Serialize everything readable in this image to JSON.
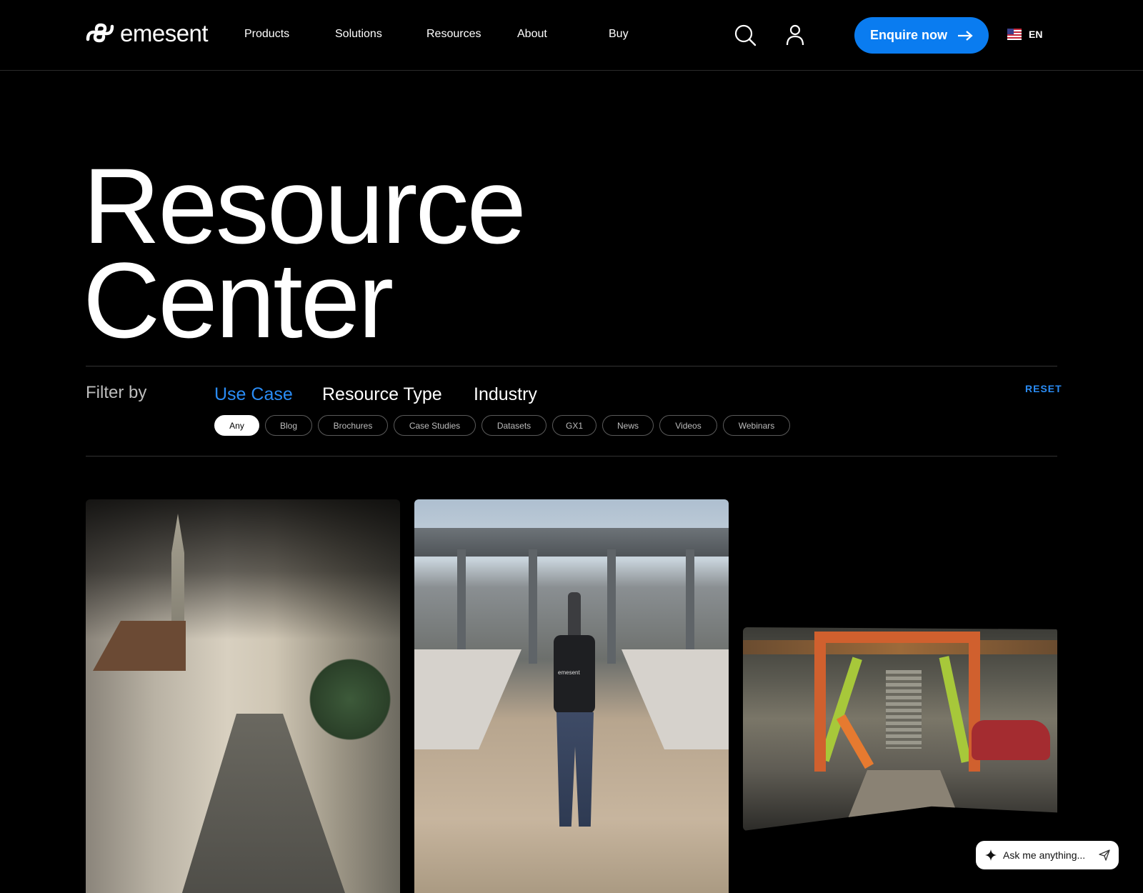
{
  "header": {
    "logo_text": "emesent",
    "nav": [
      {
        "label": "Products"
      },
      {
        "label": "Solutions"
      },
      {
        "label": "Resources"
      },
      {
        "label": "About"
      },
      {
        "label": "Buy"
      }
    ],
    "cta_label": "Enquire now",
    "language": "EN"
  },
  "hero": {
    "title_line1": "Resource",
    "title_line2": "Center"
  },
  "filters": {
    "label": "Filter by",
    "tabs": [
      {
        "label": "Use Case",
        "active": true
      },
      {
        "label": "Resource Type",
        "active": false
      },
      {
        "label": "Industry",
        "active": false
      }
    ],
    "reset_label": "RESET",
    "chips": [
      {
        "label": "Any",
        "active": true
      },
      {
        "label": "Blog"
      },
      {
        "label": "Brochures"
      },
      {
        "label": "Case Studies"
      },
      {
        "label": "Datasets"
      },
      {
        "label": "GX1"
      },
      {
        "label": "News"
      },
      {
        "label": "Videos"
      },
      {
        "label": "Webinars"
      }
    ]
  },
  "cards": {
    "card2_backpack_text": "emesent"
  },
  "assistant": {
    "placeholder": "Ask me anything..."
  },
  "colors": {
    "background": "#000000",
    "accent": "#0a7cf0",
    "active_filter": "#2a8cf5"
  }
}
